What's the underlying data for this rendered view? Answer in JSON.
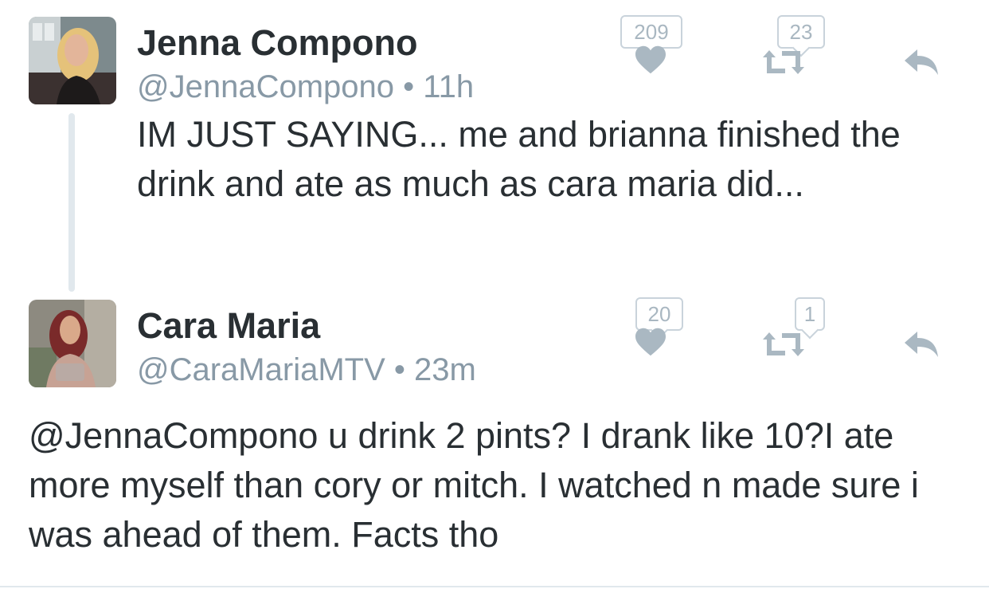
{
  "tweets": [
    {
      "name": "Jenna Compono",
      "handle": "@JennaCompono",
      "time": "11h",
      "text": "IM JUST SAYING... me and brianna finished the drink and ate as much as cara maria did...",
      "likes": "209",
      "retweets": "23"
    },
    {
      "name": "Cara Maria",
      "handle": "@CaraMariaMTV",
      "time": "23m",
      "text": "@JennaCompono u drink 2 pints? I drank like 10?I ate more myself than cory or mitch. I watched n made sure i was ahead of them. Facts tho",
      "likes": "20",
      "retweets": "1"
    }
  ],
  "separator": "•",
  "colors": {
    "text": "#292f33",
    "meta": "#8899a6",
    "icon": "#aab8c2",
    "thread_line": "#e1e8ed"
  },
  "icons": [
    "heart-icon",
    "retweet-icon",
    "reply-icon"
  ]
}
